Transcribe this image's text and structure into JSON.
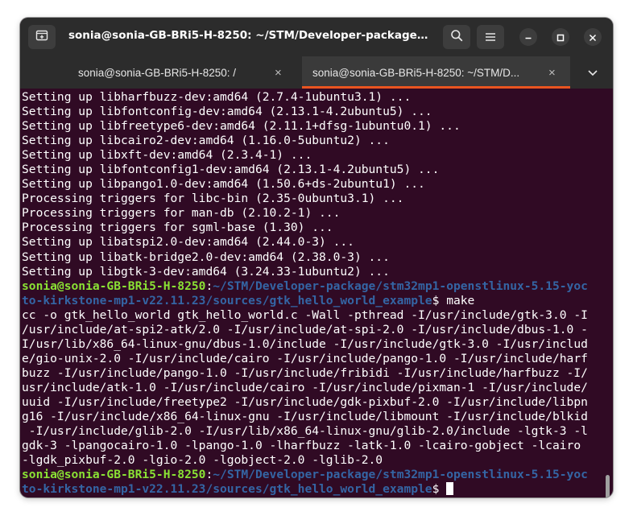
{
  "window": {
    "title": "sonia@sonia-GB-BRi5-H-8250: ~/STM/Developer-package/st..."
  },
  "tabs": [
    {
      "label": "sonia@sonia-GB-BRi5-H-8250: /",
      "active": false
    },
    {
      "label": "sonia@sonia-GB-BRi5-H-8250: ~/STM/D...",
      "active": true
    }
  ],
  "icons": {
    "new_tab": "new-tab-icon",
    "search": "search-icon",
    "menu": "hamburger-menu-icon",
    "minimize": "minimize-icon",
    "maximize": "maximize-icon",
    "close": "close-icon",
    "tab_close": "×",
    "tab_dropdown": "chevron-down-icon"
  },
  "colors": {
    "terminal_bg": "#300a24",
    "prompt_user": "#8ae234",
    "prompt_path": "#3465a4",
    "accent": "#e95420"
  },
  "terminal": {
    "output_lines_1": [
      "Setting up libharfbuzz-dev:amd64 (2.7.4-1ubuntu3.1) ...",
      "Setting up libfontconfig-dev:amd64 (2.13.1-4.2ubuntu5) ...",
      "Setting up libfreetype6-dev:amd64 (2.11.1+dfsg-1ubuntu0.1) ...",
      "Setting up libcairo2-dev:amd64 (1.16.0-5ubuntu2) ...",
      "Setting up libxft-dev:amd64 (2.3.4-1) ...",
      "Setting up libfontconfig1-dev:amd64 (2.13.1-4.2ubuntu5) ...",
      "Setting up libpango1.0-dev:amd64 (1.50.6+ds-2ubuntu1) ...",
      "Processing triggers for libc-bin (2.35-0ubuntu3.1) ...",
      "Processing triggers for man-db (2.10.2-1) ...",
      "Processing triggers for sgml-base (1.30) ...",
      "Setting up libatspi2.0-dev:amd64 (2.44.0-3) ...",
      "Setting up libatk-bridge2.0-dev:amd64 (2.38.0-3) ...",
      "Setting up libgtk-3-dev:amd64 (3.24.33-1ubuntu2) ..."
    ],
    "prompt1": {
      "user": "sonia@sonia-GB-BRi5-H-8250",
      "colon": ":",
      "path_line1": "~/STM/Developer-package/stm32mp1-openstlinux-5.15-yoc",
      "path_line2": "to-kirkstone-mp1-v22.11.23/sources/gtk_hello_world_example",
      "symbol": "$",
      "command": " make"
    },
    "output_lines_2": [
      "cc -o gtk_hello_world gtk_hello_world.c -Wall -pthread -I/usr/include/gtk-3.0 -I",
      "/usr/include/at-spi2-atk/2.0 -I/usr/include/at-spi-2.0 -I/usr/include/dbus-1.0 -",
      "I/usr/lib/x86_64-linux-gnu/dbus-1.0/include -I/usr/include/gtk-3.0 -I/usr/includ",
      "e/gio-unix-2.0 -I/usr/include/cairo -I/usr/include/pango-1.0 -I/usr/include/harf",
      "buzz -I/usr/include/pango-1.0 -I/usr/include/fribidi -I/usr/include/harfbuzz -I/",
      "usr/include/atk-1.0 -I/usr/include/cairo -I/usr/include/pixman-1 -I/usr/include/",
      "uuid -I/usr/include/freetype2 -I/usr/include/gdk-pixbuf-2.0 -I/usr/include/libpn",
      "g16 -I/usr/include/x86_64-linux-gnu -I/usr/include/libmount -I/usr/include/blkid",
      " -I/usr/include/glib-2.0 -I/usr/lib/x86_64-linux-gnu/glib-2.0/include -lgtk-3 -l",
      "gdk-3 -lpangocairo-1.0 -lpango-1.0 -lharfbuzz -latk-1.0 -lcairo-gobject -lcairo",
      "-lgdk_pixbuf-2.0 -lgio-2.0 -lgobject-2.0 -lglib-2.0"
    ],
    "prompt2": {
      "user": "sonia@sonia-GB-BRi5-H-8250",
      "colon": ":",
      "path_line1": "~/STM/Developer-package/stm32mp1-openstlinux-5.15-yoc",
      "path_line2": "to-kirkstone-mp1-v22.11.23/sources/gtk_hello_world_example",
      "symbol": "$",
      "command": " "
    }
  }
}
